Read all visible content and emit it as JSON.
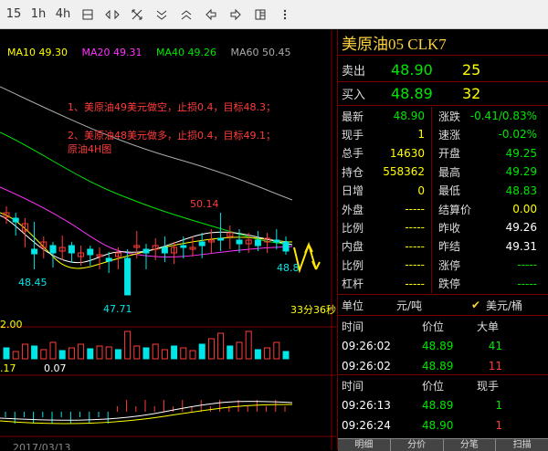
{
  "toolbar": {
    "buttons": [
      {
        "label": "15"
      },
      {
        "label": "1h"
      },
      {
        "label": "4h"
      },
      {
        "icon": "day-icon"
      },
      {
        "icon": "shrink-horizontal-icon"
      },
      {
        "icon": "expand-icon"
      },
      {
        "icon": "chevron-down-icon"
      },
      {
        "icon": "chevron-up-icon"
      },
      {
        "icon": "arrow-left-icon"
      },
      {
        "icon": "arrow-right-icon"
      },
      {
        "icon": "layout-icon"
      },
      {
        "icon": "more-icon"
      }
    ]
  },
  "chart": {
    "ma": {
      "ma10": "MA10 49.30",
      "ma20": "MA20 49.31",
      "ma40": "MA40 49.26",
      "ma60": "MA60 50.45"
    },
    "ma_colors": {
      "ma10": "#ffff00",
      "ma20": "#ff33ff",
      "ma40": "#00e600",
      "ma60": "#aaaaaa"
    },
    "annotations": {
      "line1": "1、美原油49美元做空，止损0.4，目标48.3；",
      "line2": "2、美原油48美元做多，止损0.4，目标49.1；",
      "line3": "原油4H图"
    },
    "price_labels": {
      "high": "50.14",
      "low_left": "48.45",
      "low_bottom": "47.71",
      "last": "48.8",
      "countdown": "33分36秒"
    },
    "volume": {
      "level": "2.00"
    },
    "macd": {
      "val1": ".17",
      "val2": "0.07"
    },
    "date_label": "2017/03/13"
  },
  "quote": {
    "title": "美原油05 CLK7",
    "sell": {
      "label": "卖出",
      "price": "48.90",
      "qty": "25"
    },
    "buy": {
      "label": "买入",
      "price": "48.89",
      "qty": "32"
    },
    "stats": [
      {
        "l": "最新",
        "v": "48.90",
        "lc": "green",
        "r": "涨跌",
        "rv": "-0.41/0.83%",
        "rc": "green"
      },
      {
        "l": "现手",
        "v": "1",
        "lc": "yellow",
        "r": "速涨",
        "rv": "-0.02%",
        "rc": "green"
      },
      {
        "l": "总手",
        "v": "14630",
        "lc": "yellow",
        "r": "开盘",
        "rv": "49.25",
        "rc": "green"
      },
      {
        "l": "持仓",
        "v": "558362",
        "lc": "yellow",
        "r": "最高",
        "rv": "49.29",
        "rc": "green"
      },
      {
        "l": "日增",
        "v": "0",
        "lc": "yellow",
        "r": "最低",
        "rv": "48.83",
        "rc": "green"
      },
      {
        "l": "外盘",
        "v": "-----",
        "lc": "yellow",
        "r": "结算价",
        "rv": "0.00",
        "rc": "yellow"
      },
      {
        "l": "比例",
        "v": "-----",
        "lc": "yellow",
        "r": "昨收",
        "rv": "49.26",
        "rc": "white"
      },
      {
        "l": "内盘",
        "v": "-----",
        "lc": "yellow",
        "r": "昨结",
        "rv": "49.31",
        "rc": "white"
      },
      {
        "l": "比例",
        "v": "-----",
        "lc": "yellow",
        "r": "涨停",
        "rv": "-----",
        "rc": "green"
      },
      {
        "l": "杠杆",
        "v": "-----",
        "lc": "yellow",
        "r": "跌停",
        "rv": "-----",
        "rc": "green"
      }
    ],
    "unit": {
      "label": "单位",
      "unit_value": "元/吨",
      "selected": "美元/桶"
    },
    "trades_header": {
      "time": "时间",
      "price": "价位",
      "size": "大单"
    },
    "trades": [
      {
        "time": "09:26:02",
        "price": "48.89",
        "size": "41",
        "sc": "green"
      },
      {
        "time": "09:26:02",
        "price": "48.89",
        "size": "11",
        "sc": "red"
      }
    ],
    "ticks_header": {
      "time": "时间",
      "price": "价位",
      "size": "现手"
    },
    "ticks": [
      {
        "time": "09:26:13",
        "price": "48.89",
        "size": "1",
        "sc": "green"
      },
      {
        "time": "09:26:24",
        "price": "48.90",
        "size": "1",
        "sc": "red"
      }
    ],
    "tabs": [
      "明细",
      "分价",
      "分笔",
      "扫描"
    ]
  }
}
